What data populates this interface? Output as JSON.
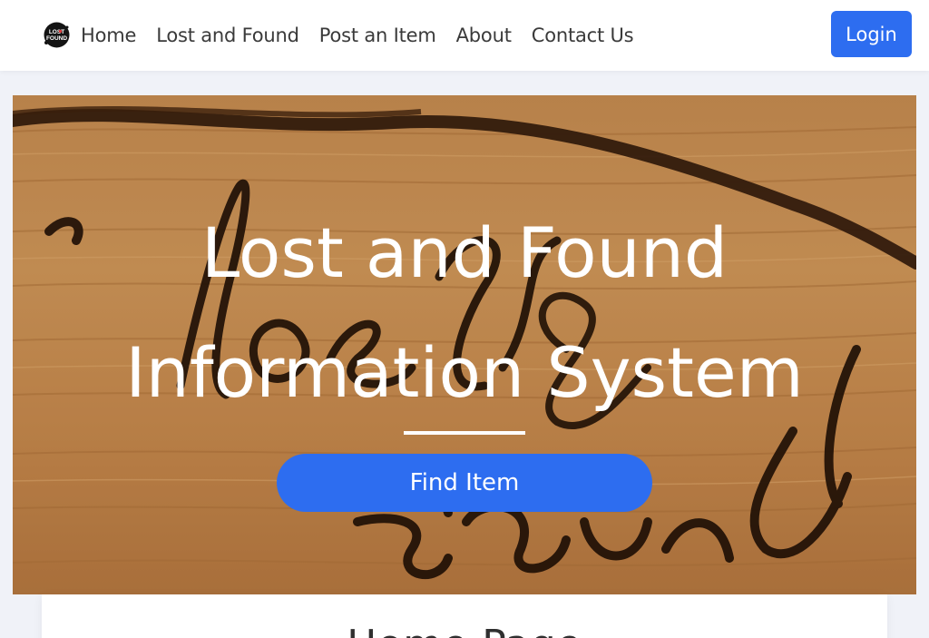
{
  "brand": {
    "logo_icon": "lost-and-found-logo-icon",
    "logo_text_line1": "LOST",
    "logo_text_line2": "FOUND"
  },
  "nav": {
    "items": [
      {
        "label": "Home"
      },
      {
        "label": "Lost and Found"
      },
      {
        "label": "Post an Item"
      },
      {
        "label": "About"
      },
      {
        "label": "Contact Us"
      }
    ],
    "login_label": "Login"
  },
  "hero": {
    "title": "Lost and Found Information System",
    "button_label": "Find Item",
    "background_image": "wood-carving-lost-found-image"
  },
  "section": {
    "title": "Home Page"
  },
  "colors": {
    "primary": "#2d6df0",
    "nav_text": "#3a3a3a",
    "page_bg": "#f0f2f8"
  }
}
